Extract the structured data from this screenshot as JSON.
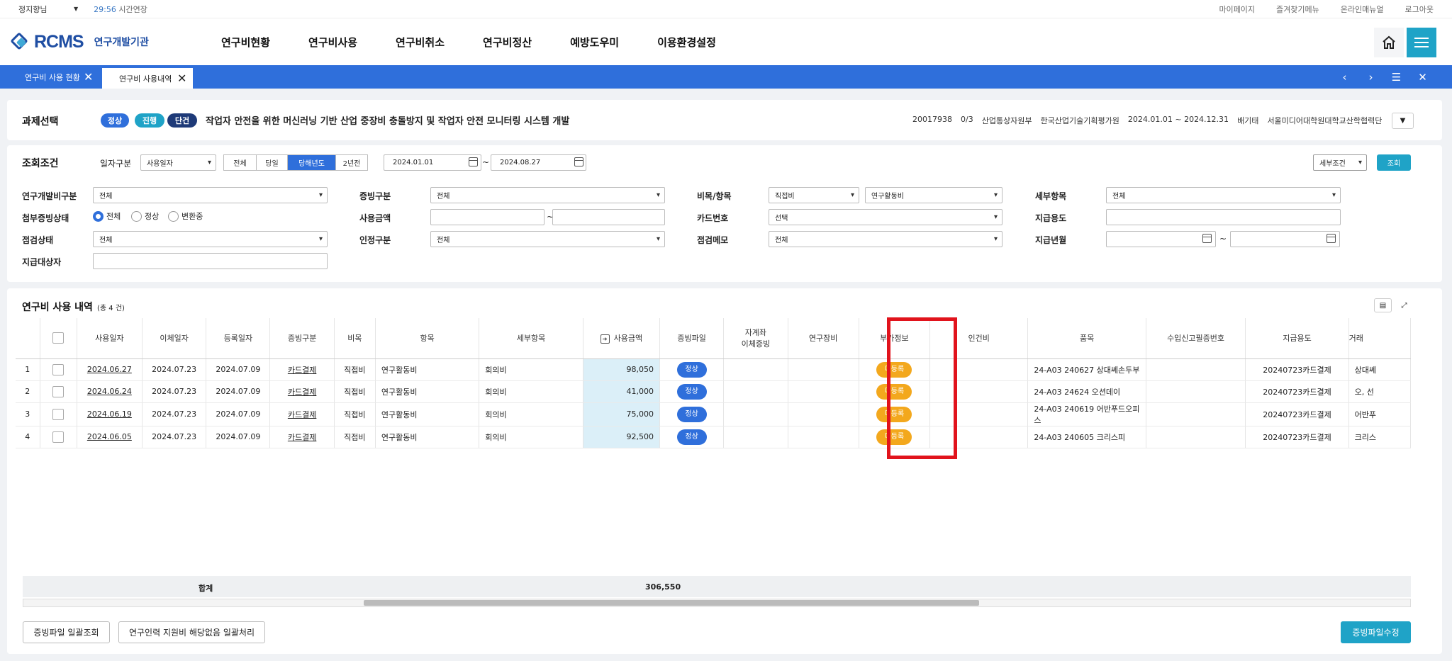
{
  "topbar": {
    "user": "정지향님",
    "time": "29:56",
    "extend": "시간연장",
    "links": [
      "마이페이지",
      "즐겨찾기메뉴",
      "온라인매뉴얼",
      "로그아웃"
    ]
  },
  "header": {
    "logo": "RCMS",
    "org": "연구개발기관",
    "menu": [
      "연구비현황",
      "연구비사용",
      "연구비취소",
      "연구비정산",
      "예방도우미",
      "이용환경설정"
    ]
  },
  "tabs": [
    {
      "label": "연구비 사용 현황"
    },
    {
      "label": "연구비 사용내역"
    }
  ],
  "project": {
    "title": "과제선택",
    "badges": [
      "정상",
      "진행",
      "단건"
    ],
    "name": "작업자 안전을 위한 머신러닝 기반 산업 중장비 충돌방지 및 작업자 안전 모니터링 시스템 개발",
    "info": [
      "20017938",
      "0/3",
      "산업통상자원부",
      "한국산업기술기획평가원",
      "2024.01.01 ~ 2024.12.31",
      "배기태",
      "서울미디어대학원대학교산학협력단"
    ]
  },
  "search": {
    "title": "조회조건",
    "date_type_label": "일자구분",
    "date_type": "사용일자",
    "seg": [
      "전체",
      "당일",
      "당해년도",
      "2년전"
    ],
    "date_from": "2024.01.01",
    "tilde": "~",
    "date_to": "2024.08.27",
    "detail_btn": "세부조건",
    "search_btn": "조회",
    "fields": {
      "l1": "연구개발비구분",
      "v1": "전체",
      "l2": "증빙구분",
      "v2": "전체",
      "l3": "비목/항목",
      "v3a": "직접비",
      "v3b": "연구활동비",
      "l4": "세부항목",
      "v4": "전체",
      "l5": "첨부증빙상태",
      "r1": "전체",
      "r2": "정상",
      "r3": "변환중",
      "l6": "사용금액",
      "l7": "카드번호",
      "v7": "선택",
      "l8": "지급용도",
      "l9": "점검상태",
      "v9": "전체",
      "l10": "인정구분",
      "v10": "전체",
      "l11": "점검메모",
      "v11": "전체",
      "l12": "지급년월",
      "l13": "지급대상자"
    }
  },
  "list": {
    "title": "연구비 사용 내역",
    "count": "(총 4 건)",
    "headers": [
      "사용일자",
      "이체일자",
      "등록일자",
      "증빙구분",
      "비목",
      "항목",
      "세부항목",
      "사용금액",
      "증빙파일",
      "자계좌\n이체증빙",
      "연구장비",
      "부가정보",
      "인건비",
      "품목",
      "수입신고필증번호",
      "지급용도",
      "거래"
    ],
    "rows": [
      {
        "no": "1",
        "use": "2024.06.27",
        "trans": "2024.07.23",
        "reg": "2024.07.09",
        "ev": "카드결제",
        "bm": "직접비",
        "item": "연구활동비",
        "sub": "회의비",
        "amt": "98,050",
        "file": "정상",
        "extra": "미등록",
        "product": "24-A03 240627 상대쎄손두부",
        "purpose": "20240723카드결제",
        "vendor": "상대쎄"
      },
      {
        "no": "2",
        "use": "2024.06.24",
        "trans": "2024.07.23",
        "reg": "2024.07.09",
        "ev": "카드결제",
        "bm": "직접비",
        "item": "연구활동비",
        "sub": "회의비",
        "amt": "41,000",
        "file": "정상",
        "extra": "미등록",
        "product": "24-A03 24624 오션데이",
        "purpose": "20240723카드결제",
        "vendor": "오, 선"
      },
      {
        "no": "3",
        "use": "2024.06.19",
        "trans": "2024.07.23",
        "reg": "2024.07.09",
        "ev": "카드결제",
        "bm": "직접비",
        "item": "연구활동비",
        "sub": "회의비",
        "amt": "75,000",
        "file": "정상",
        "extra": "미등록",
        "product": "24-A03 240619 어반푸드오피스",
        "purpose": "20240723카드결제",
        "vendor": "어반푸"
      },
      {
        "no": "4",
        "use": "2024.06.05",
        "trans": "2024.07.23",
        "reg": "2024.07.09",
        "ev": "카드결제",
        "bm": "직접비",
        "item": "연구활동비",
        "sub": "회의비",
        "amt": "92,500",
        "file": "정상",
        "extra": "미등록",
        "product": "24-A03 240605 크리스피",
        "purpose": "20240723카드결제",
        "vendor": "크리스"
      }
    ],
    "sum_label": "합계",
    "sum": "306,550"
  },
  "buttons": {
    "bulk_view": "증빙파일 일괄조회",
    "bulk_none": "연구인력 지원비 해당없음 일괄처리",
    "edit": "증빙파일수정"
  },
  "colors": {
    "accent": "#2f6fdb",
    "teal": "#1fa3c7",
    "orange": "#f3a81d",
    "highlight": "#e1131c"
  }
}
